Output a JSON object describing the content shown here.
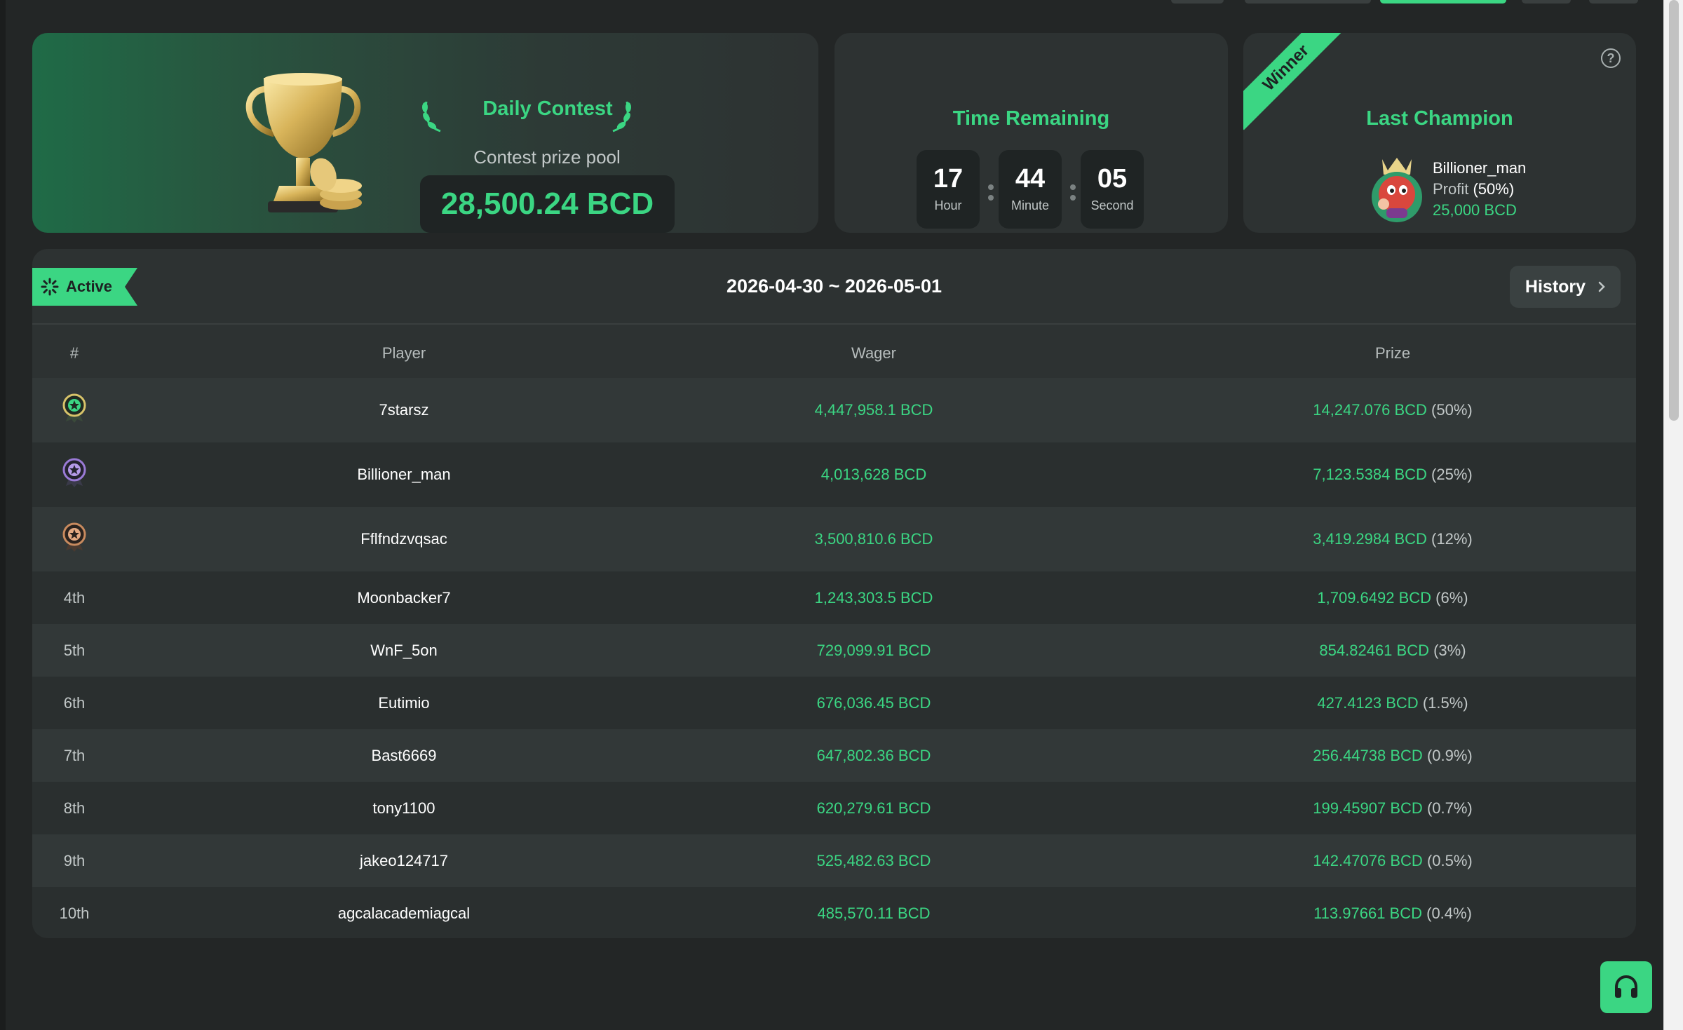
{
  "contest": {
    "title": "Daily Contest",
    "pool_label": "Contest prize pool",
    "pool_amount": "28,500.24 BCD"
  },
  "timer": {
    "title": "Time Remaining",
    "hours": "17",
    "hours_label": "Hour",
    "minutes": "44",
    "minutes_label": "Minute",
    "seconds": "05",
    "seconds_label": "Second"
  },
  "champion": {
    "ribbon": "Winner",
    "title": "Last Champion",
    "name": "Billioner_man",
    "profit_label": "Profit",
    "profit_pct": "(50%)",
    "amount": "25,000 BCD"
  },
  "board": {
    "status": "Active",
    "date_range": "2026-04-30 ~ 2026-05-01",
    "history_label": "History",
    "columns": [
      "#",
      "Player",
      "Wager",
      "Prize"
    ],
    "rows": [
      {
        "rank": "",
        "medal": "gold",
        "player": "7starsz",
        "wager": "4,447,958.1 BCD",
        "prize": "14,247.076 BCD",
        "pct": "(50%)"
      },
      {
        "rank": "",
        "medal": "silver",
        "player": "Billioner_man",
        "wager": "4,013,628 BCD",
        "prize": "7,123.5384 BCD",
        "pct": "(25%)"
      },
      {
        "rank": "",
        "medal": "bronze",
        "player": "Fflfndzvqsac",
        "wager": "3,500,810.6 BCD",
        "prize": "3,419.2984 BCD",
        "pct": "(12%)"
      },
      {
        "rank": "4th",
        "medal": "",
        "player": "Moonbacker7",
        "wager": "1,243,303.5 BCD",
        "prize": "1,709.6492 BCD",
        "pct": "(6%)"
      },
      {
        "rank": "5th",
        "medal": "",
        "player": "WnF_5on",
        "wager": "729,099.91 BCD",
        "prize": "854.82461 BCD",
        "pct": "(3%)"
      },
      {
        "rank": "6th",
        "medal": "",
        "player": "Eutimio",
        "wager": "676,036.45 BCD",
        "prize": "427.4123 BCD",
        "pct": "(1.5%)"
      },
      {
        "rank": "7th",
        "medal": "",
        "player": "Bast6669",
        "wager": "647,802.36 BCD",
        "prize": "256.44738 BCD",
        "pct": "(0.9%)"
      },
      {
        "rank": "8th",
        "medal": "",
        "player": "tony1100",
        "wager": "620,279.61 BCD",
        "prize": "199.45907 BCD",
        "pct": "(0.7%)"
      },
      {
        "rank": "9th",
        "medal": "",
        "player": "jakeo124717",
        "wager": "525,482.63 BCD",
        "prize": "142.47076 BCD",
        "pct": "(0.5%)"
      },
      {
        "rank": "10th",
        "medal": "",
        "player": "agcalacademiagcal",
        "wager": "485,570.11 BCD",
        "prize": "113.97661 BCD",
        "pct": "(0.4%)"
      }
    ]
  },
  "colors": {
    "accent": "#3bd683",
    "background": "#232626",
    "card": "#2d3232",
    "medal_gold": "#d8c36a",
    "medal_silver": "#9a7ad6",
    "medal_bronze": "#c88a5e"
  },
  "icons": {
    "support": "headset-icon",
    "help": "question-circle-icon",
    "history_chevron": "chevron-right-icon",
    "active_spinner": "spinner-icon"
  }
}
